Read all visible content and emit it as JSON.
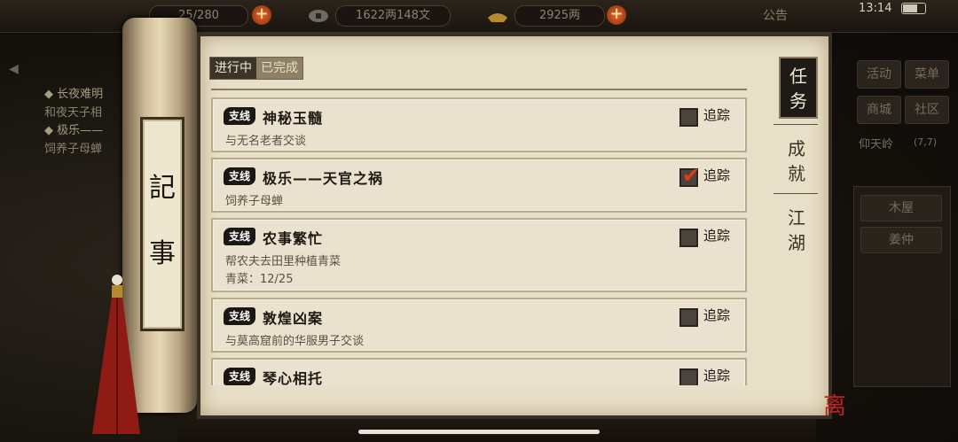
{
  "status": {
    "time": "13:14"
  },
  "topbar": {
    "stamina": "25/280",
    "copper": "1622两148文",
    "silver": "2925两",
    "notice": "公告"
  },
  "left_tasks": [
    {
      "name": "◆ 长夜难明",
      "desc": "和夜天子相"
    },
    {
      "name": "◆ 极乐——",
      "desc": "饲养子母蝉"
    }
  ],
  "right_panel": {
    "buttons": [
      "活动",
      "菜单",
      "商城",
      "社区"
    ],
    "location": "仰天岭",
    "coord": "(7,7)",
    "npcs": [
      "木屋",
      "姜仲"
    ]
  },
  "journal": {
    "scroll_label": [
      "記",
      "事"
    ],
    "tabs": [
      "进行中",
      "已完成"
    ],
    "side_tabs": [
      "任务",
      "成就",
      "江湖"
    ],
    "tasks": [
      {
        "type": "支线",
        "title": "神秘玉髓",
        "desc": [
          "与无名老者交谈"
        ],
        "track_label": "追踪",
        "tracked": false
      },
      {
        "type": "支线",
        "title": "极乐——天官之祸",
        "desc": [
          "饲养子母蝉"
        ],
        "track_label": "追踪",
        "tracked": true
      },
      {
        "type": "支线",
        "title": "农事繁忙",
        "desc": [
          "帮农夫去田里种植青菜",
          "青菜：12/25"
        ],
        "track_label": "追踪",
        "tracked": false
      },
      {
        "type": "支线",
        "title": "敦煌凶案",
        "desc": [
          "与莫高窟前的华服男子交谈"
        ],
        "track_label": "追踪",
        "tracked": false
      },
      {
        "type": "支线",
        "title": "琴心相托",
        "desc": [],
        "track_label": "追踪",
        "tracked": false
      }
    ]
  },
  "colors": {
    "accent": "#e03a18",
    "paper": "#e8dfc8",
    "frame": "#3a2f24"
  }
}
